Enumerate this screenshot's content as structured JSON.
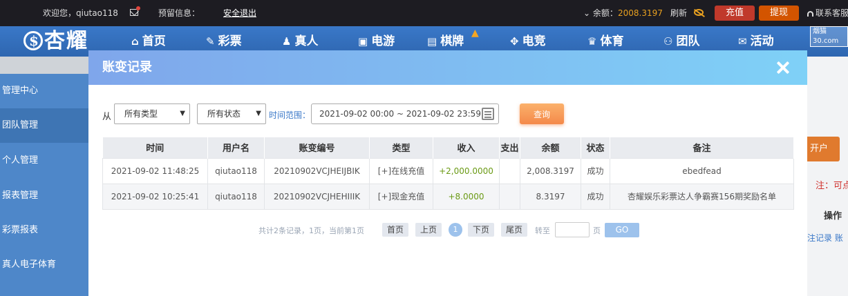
{
  "topbar": {
    "welcome": "欢迎您，qiutao118",
    "reserve_info": "预留信息：",
    "logout": "安全退出",
    "balance_label": "⌄ 余额：",
    "balance_value": "2008.3197",
    "refresh": "刷新",
    "recharge": "充值",
    "withdraw": "提现",
    "service": "联系客服"
  },
  "nav": {
    "logo": "杏耀",
    "items": [
      {
        "icon": "⌂",
        "label": "首页"
      },
      {
        "icon": "✎",
        "label": "彩票"
      },
      {
        "icon": "♟",
        "label": "真人"
      },
      {
        "icon": "▣",
        "label": "电游"
      },
      {
        "icon": "▤",
        "label": "棋牌"
      },
      {
        "icon": "✥",
        "label": "电竞"
      },
      {
        "icon": "♛",
        "label": "体育"
      },
      {
        "icon": "⚇",
        "label": "团队"
      },
      {
        "icon": "✉",
        "label": "活动"
      }
    ],
    "watermark": "烟猫30.com"
  },
  "sidebar": {
    "items": [
      {
        "label": "管理中心"
      },
      {
        "label": "团队管理"
      },
      {
        "label": "个人管理"
      },
      {
        "label": "报表管理"
      },
      {
        "label": "彩票报表"
      },
      {
        "label": "真人电子体育"
      }
    ]
  },
  "background": {
    "open_account": "开户",
    "note": "注：可点",
    "op_header": "操作",
    "links": "注记录 账"
  },
  "modal": {
    "title": "账变记录",
    "filters": {
      "from_label": "从",
      "type_select": "所有类型",
      "status_select": "所有状态",
      "range_label": "时间范围：",
      "range_value": "2021-09-02 00:00 ~ 2021-09-02 23:59",
      "query_button": "查询"
    },
    "table": {
      "columns": [
        "时间",
        "用户名",
        "账变编号",
        "类型",
        "收入",
        "支出",
        "余额",
        "状态",
        "备注"
      ],
      "rows": [
        [
          "2021-09-02 11:48:25",
          "qiutao118",
          "20210902VCJHEIJBIK",
          "[+]在线充值",
          "+2,000.0000",
          "",
          "2,008.3197",
          "成功",
          "ebedfead"
        ],
        [
          "2021-09-02 10:25:41",
          "qiutao118",
          "20210902VCJHEHIIIK",
          "[+]现金充值",
          "+8.0000",
          "",
          "8.3197",
          "成功",
          "杏耀娱乐彩票达人争霸赛156期奖励名单"
        ]
      ]
    },
    "pagination": {
      "summary": "共计2条记录，1页，当前第1页",
      "first": "首页",
      "prev": "上页",
      "current": "1",
      "next": "下页",
      "last": "尾页",
      "goto_label": "转至",
      "page_unit": "页",
      "go": "GO"
    }
  }
}
